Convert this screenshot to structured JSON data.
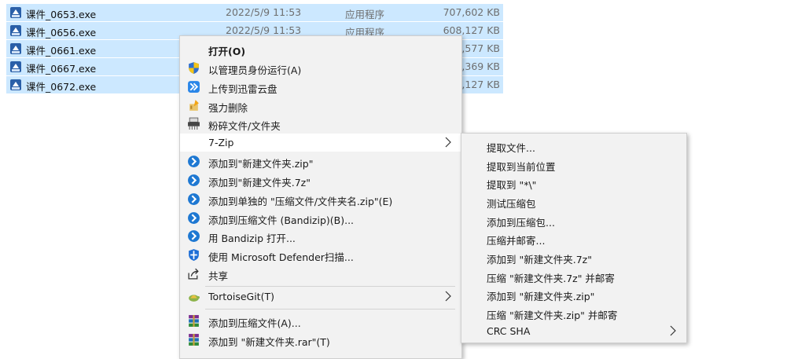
{
  "files": [
    {
      "name": "课件_0653.exe",
      "date": "2022/5/9 11:53",
      "type": "应用程序",
      "size": "707,602 KB"
    },
    {
      "name": "课件_0656.exe",
      "date": "2022/5/9 11:53",
      "type": "应用程序",
      "size": "608,127 KB"
    },
    {
      "name": "课件_0661.exe",
      "date": "",
      "type": "",
      "size": "0,577 KB"
    },
    {
      "name": "课件_0667.exe",
      "date": "",
      "type": "",
      "size": "0,369 KB"
    },
    {
      "name": "课件_0672.exe",
      "date": "",
      "type": "",
      "size": "5,127 KB"
    }
  ],
  "context_menu": {
    "items": [
      {
        "label": "打开(O)",
        "icon": "none"
      },
      {
        "label": "以管理员身份运行(A)",
        "icon": "uac-shield-icon"
      },
      {
        "label": "上传到迅雷云盘",
        "icon": "thunder-cloud-icon"
      },
      {
        "label": "强力删除",
        "icon": "force-delete-icon"
      },
      {
        "label": "粉碎文件/文件夹",
        "icon": "shredder-icon"
      },
      {
        "label": "7-Zip",
        "icon": "none"
      },
      {
        "label": "添加到\"新建文件夹.zip\"",
        "icon": "bandizip-icon"
      },
      {
        "label": "添加到\"新建文件夹.7z\"",
        "icon": "bandizip-icon"
      },
      {
        "label": "添加到单独的 \"压缩文件/文件夹名.zip\"(E)",
        "icon": "bandizip-icon"
      },
      {
        "label": "添加到压缩文件 (Bandizip)(B)...",
        "icon": "bandizip-icon"
      },
      {
        "label": "用 Bandizip 打开...",
        "icon": "bandizip-icon"
      },
      {
        "label": "使用 Microsoft Defender扫描...",
        "icon": "defender-icon"
      },
      {
        "label": "共享",
        "icon": "share-icon"
      },
      {
        "label": "TortoiseGit(T)",
        "icon": "tortoisegit-icon"
      },
      {
        "label": "添加到压缩文件(A)...",
        "icon": "winrar-icon"
      },
      {
        "label": "添加到 \"新建文件夹.rar\"(T)",
        "icon": "winrar-icon"
      }
    ]
  },
  "zip_submenu": {
    "items": [
      {
        "label": "提取文件..."
      },
      {
        "label": "提取到当前位置"
      },
      {
        "label": "提取到 \"*\\\""
      },
      {
        "label": "测试压缩包"
      },
      {
        "label": "添加到压缩包..."
      },
      {
        "label": "压缩并邮寄..."
      },
      {
        "label": "添加到 \"新建文件夹.7z\""
      },
      {
        "label": "压缩 \"新建文件夹.7z\" 并邮寄"
      },
      {
        "label": "添加到 \"新建文件夹.zip\""
      },
      {
        "label": "压缩 \"新建文件夹.zip\" 并邮寄"
      },
      {
        "label": "CRC SHA"
      }
    ]
  },
  "colors": {
    "selection": "#cce8ff",
    "menu_bg": "#f2f2f2",
    "menu_highlight": "#ffffff",
    "bandizip_blue": "#1e78d2",
    "defender_blue": "#1f6fd6"
  }
}
